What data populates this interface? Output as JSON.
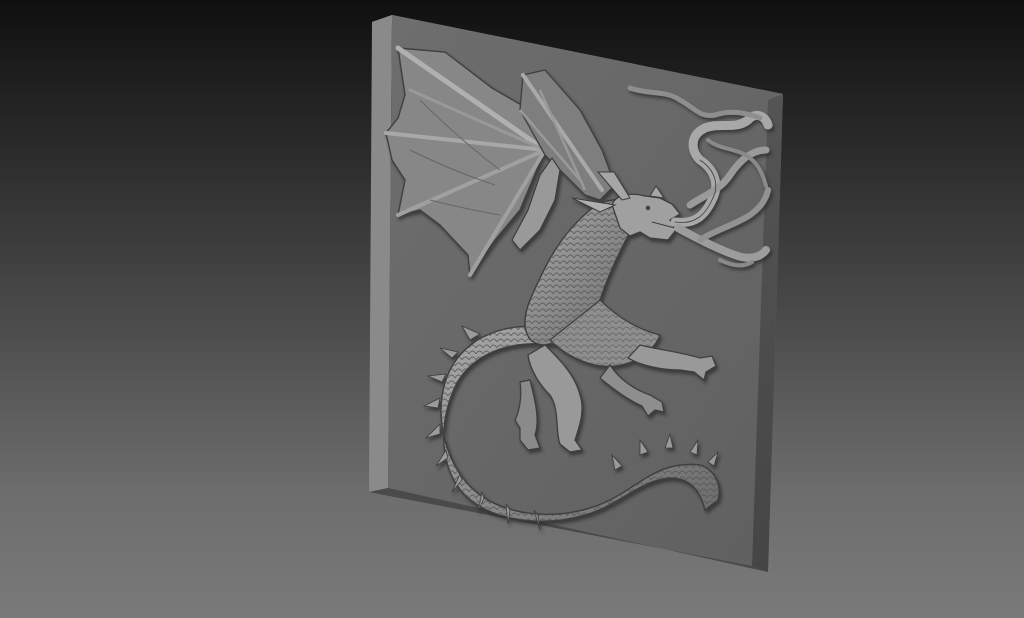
{
  "scene": {
    "subject": "dragon-relief-panel",
    "colors": {
      "background_top": "#101010",
      "background_bottom": "#7a7a7a",
      "panel_face": "#676767",
      "panel_side": "#4c4c4c",
      "panel_top": "#7c7c7c",
      "relief_light": "#a4a4a4",
      "relief_mid": "#878787",
      "relief_shadow": "#3c3c3c"
    }
  }
}
